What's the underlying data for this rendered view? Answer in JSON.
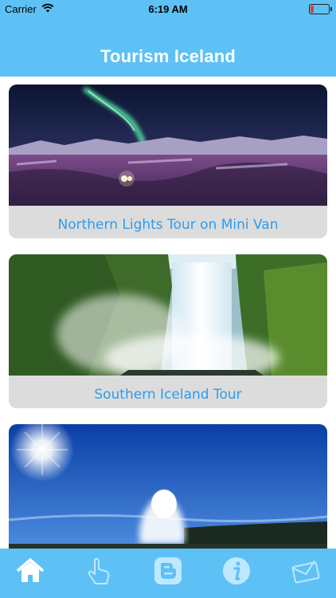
{
  "status": {
    "carrier": "Carrier",
    "time": "6:19 AM"
  },
  "header": {
    "title": "Tourism Iceland"
  },
  "cards": [
    {
      "label": "Northern Lights Tour on Mini Van",
      "image": "aurora-photo"
    },
    {
      "label": "Southern Iceland Tour",
      "image": "waterfall-photo"
    },
    {
      "label": "",
      "image": "geyser-photo"
    }
  ],
  "tabbar": {
    "items": [
      {
        "icon": "home-icon",
        "selected": true
      },
      {
        "icon": "hand-pointer-icon",
        "selected": false
      },
      {
        "icon": "blogger-icon",
        "selected": false
      },
      {
        "icon": "info-icon",
        "selected": false
      },
      {
        "icon": "mail-icon",
        "selected": false
      }
    ]
  },
  "colors": {
    "header": "#5ec1f5",
    "label": "#2b9cf0",
    "card_bg": "#dcdcdc"
  }
}
